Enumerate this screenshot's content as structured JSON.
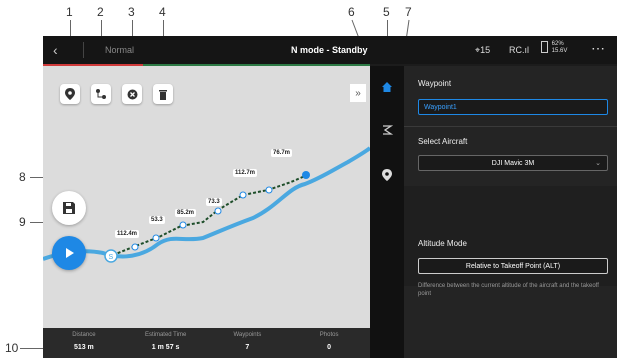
{
  "callouts": [
    "1",
    "2",
    "3",
    "4",
    "5",
    "6",
    "7",
    "8",
    "9",
    "10"
  ],
  "topbar": {
    "back_icon": "chevron-left-icon",
    "mode": "Normal",
    "status": "N mode - Standby",
    "gps": "⌖15",
    "rc": "RC.ıl",
    "battery_percent": "62%",
    "battery_voltage": "15.6V",
    "more_icon": "more-icon"
  },
  "toolbar": {
    "icons": [
      "waypoint-pin-icon",
      "route-settings-icon",
      "delete-circle-icon",
      "trash-icon"
    ],
    "collapse": "»"
  },
  "map": {
    "labels": [
      "76.7m",
      "112.7m",
      "73.3",
      "85.2m",
      "53.3",
      "112.4m"
    ],
    "start_marker": "S"
  },
  "buttons": {
    "save_icon": "save-icon",
    "play_icon": "play-icon"
  },
  "stats": [
    {
      "label": "Distance",
      "value": "513 m"
    },
    {
      "label": "Estimated Time",
      "value": "1 m 57 s"
    },
    {
      "label": "Waypoints",
      "value": "7"
    },
    {
      "label": "Photos",
      "value": "0"
    }
  ],
  "iconbar": [
    "home-icon",
    "route-icon",
    "waypoint-icon"
  ],
  "panel": {
    "waypoint_title": "Waypoint",
    "waypoint_value": "Waypoint1",
    "aircraft_title": "Select Aircraft",
    "aircraft_value": "DJI Mavic 3M",
    "altitude_title": "Altitude Mode",
    "altitude_value": "Relative to Takeoff Point (ALT)",
    "altitude_desc": "Difference between the current altitude of the aircraft and the takeoff point"
  },
  "colors": {
    "accent_blue": "#1e88e5",
    "route_green": "#2d7a45",
    "track_red": "#d03a3a",
    "river_blue": "#4aa8e0"
  }
}
